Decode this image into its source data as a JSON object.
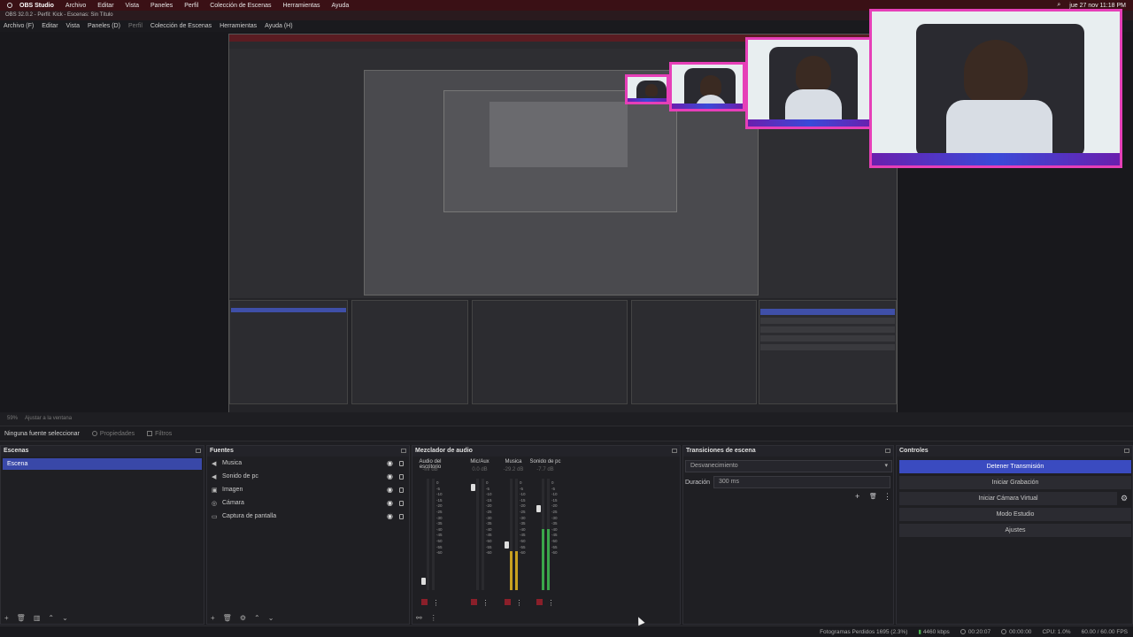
{
  "system_bar": {
    "app": "OBS Studio",
    "menus": [
      "Archivo",
      "Editar",
      "Vista",
      "Paneles",
      "Perfil",
      "Colección de Escenas",
      "Herramientas",
      "Ayuda"
    ],
    "datetime": "jue 27 nov  11:18 PM"
  },
  "window_title": "OBS 32.0.2 - Perfil: Kick - Escenas: Sin Título",
  "menubar": [
    "Archivo (F)",
    "Editar",
    "Vista",
    "Paneles (D)",
    "Perfil",
    "Colección de Escenas",
    "Herramientas",
    "Ayuda (H)"
  ],
  "zoom": {
    "level": "59%",
    "fit": "Ajustar a la ventana"
  },
  "context_bar": {
    "no_selection": "Ninguna fuente seleccionar",
    "properties": "Propiedades",
    "filters": "Filtros"
  },
  "scenes": {
    "title": "Escenas",
    "items": [
      "Escena"
    ]
  },
  "sources": {
    "title": "Fuentes",
    "items": [
      {
        "label": "Musica",
        "icon": "speaker-icon"
      },
      {
        "label": "Sonido de pc",
        "icon": "speaker-icon"
      },
      {
        "label": "Imagen",
        "icon": "image-icon"
      },
      {
        "label": "Cámara",
        "icon": "camera-icon"
      },
      {
        "label": "Captura de pantalla",
        "icon": "monitor-icon"
      }
    ]
  },
  "mixer": {
    "title": "Mezclador de audio",
    "channels": [
      {
        "name": "Audio del escritorio",
        "db": "-inf dB",
        "level": 0.0,
        "fader": 0.05,
        "color": "#3a3a3e"
      },
      {
        "name": "Mic/Aux",
        "db": "0.0 dB",
        "level": 0.0,
        "fader": 0.95,
        "color": "#3a3a3e"
      },
      {
        "name": "Musica",
        "db": "-29.2 dB",
        "level": 0.35,
        "fader": 0.4,
        "color": "#c8a020"
      },
      {
        "name": "Sonido de pc",
        "db": "-7.7 dB",
        "level": 0.55,
        "fader": 0.75,
        "color": "#3aa64a"
      }
    ],
    "scale": [
      "0",
      "-5",
      "-10",
      "-15",
      "-20",
      "-25",
      "-30",
      "-35",
      "-40",
      "-45",
      "-50",
      "-55",
      "-60"
    ]
  },
  "transitions": {
    "title": "Transiciones de escena",
    "selected": "Desvanecimiento",
    "duration_label": "Duración",
    "duration_value": "300 ms"
  },
  "controls": {
    "title": "Controles",
    "buttons": [
      "Detener Transmisión",
      "Iniciar Grabación",
      "Iniciar Cámara Virtual",
      "Modo Estudio",
      "Ajustes"
    ]
  },
  "status": {
    "dropped": "Fotogramas Perdidos 1695 (2.3%)",
    "bitrate": "4460 kbps",
    "stream_time": "00:20:07",
    "rec_time": "00:00:00",
    "cpu": "CPU: 1.0%",
    "fps": "60.00 / 60.00 FPS"
  },
  "colors": {
    "accent": "#3a4bc0",
    "overlay_frame": "#e63fb8",
    "title_bar": "#3a1015"
  }
}
